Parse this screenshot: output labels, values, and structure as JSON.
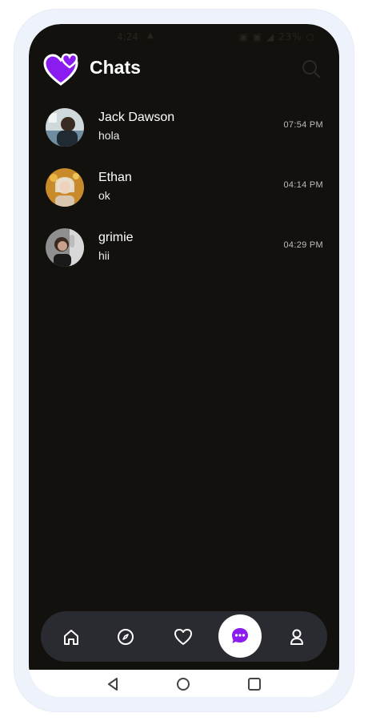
{
  "status_bar": {
    "time": "4:24",
    "battery": "23%"
  },
  "header": {
    "title": "Chats"
  },
  "chats": [
    {
      "name": "Jack Dawson",
      "message": "hola",
      "time": "07:54 PM"
    },
    {
      "name": "Ethan",
      "message": "ok",
      "time": "04:14 PM"
    },
    {
      "name": "grimie",
      "message": "hii",
      "time": "04:29 PM"
    }
  ],
  "bottom_nav": {
    "items": [
      "home-icon",
      "compass-icon",
      "heart-icon",
      "chat-icon",
      "profile-icon"
    ],
    "active": "chat-icon",
    "accent_color": "#8a1cf0"
  },
  "system_nav": {
    "items": [
      "back-icon",
      "home-circle-icon",
      "recents-icon"
    ]
  },
  "colors": {
    "background": "#12110d",
    "accent": "#8a1cf0",
    "text": "#ffffff"
  }
}
